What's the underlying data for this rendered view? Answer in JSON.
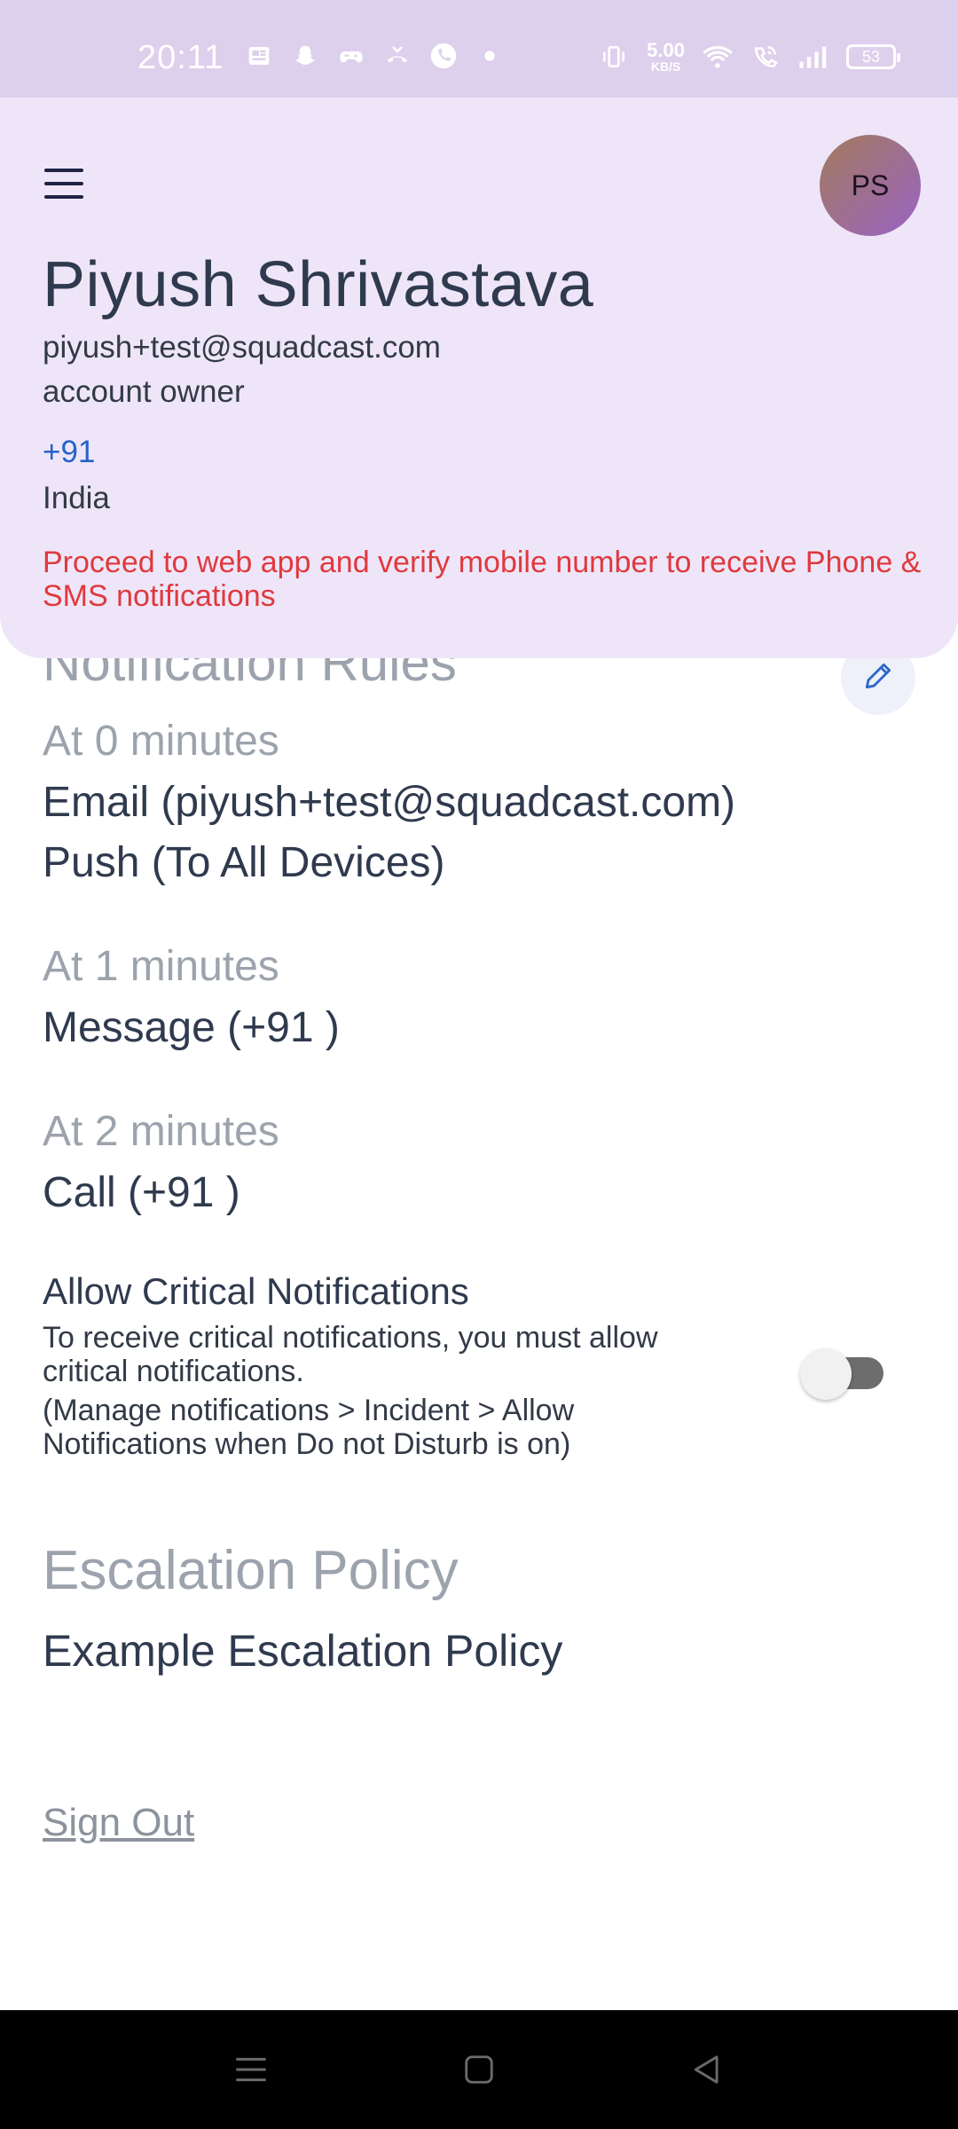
{
  "status_bar": {
    "time": "20:11",
    "net_speed_value": "5.00",
    "net_speed_unit": "KB/S",
    "battery_level": "53",
    "background": "#ddd0ec"
  },
  "profile": {
    "avatar_initials": "PS",
    "name": "Piyush Shrivastava",
    "email": "piyush+test@squadcast.com",
    "role": "account owner",
    "phone": "+91",
    "country": "India",
    "verify_warning": "Proceed to web app and verify mobile number to receive Phone & SMS notifications",
    "card_background": "#eee6f8",
    "warning_color": "#e0393e",
    "phone_color": "#2563c9"
  },
  "notification_rules": {
    "title": "Notification Rules",
    "rules": [
      {
        "time": "At 0 minutes",
        "items": [
          "Email (piyush+test@squadcast.com)",
          "Push (To All Devices)"
        ]
      },
      {
        "time": "At 1 minutes",
        "items": [
          "Message (+91  )"
        ]
      },
      {
        "time": "At 2 minutes",
        "items": [
          "Call (+91  )"
        ]
      }
    ]
  },
  "critical_notifications": {
    "title": "Allow Critical Notifications",
    "description": "To receive critical notifications, you must allow critical notifications.",
    "instructions": "(Manage notifications > Incident > Allow Notifications when Do not Disturb is on)",
    "enabled": false
  },
  "escalation_policy": {
    "title": "Escalation Policy",
    "value": "Example Escalation Policy"
  },
  "sign_out_label": "Sign Out",
  "icons": {
    "menu": "hamburger-menu-icon",
    "edit": "pencil-icon",
    "nav_recent": "recent-apps-icon",
    "nav_home": "home-icon",
    "nav_back": "back-icon"
  }
}
